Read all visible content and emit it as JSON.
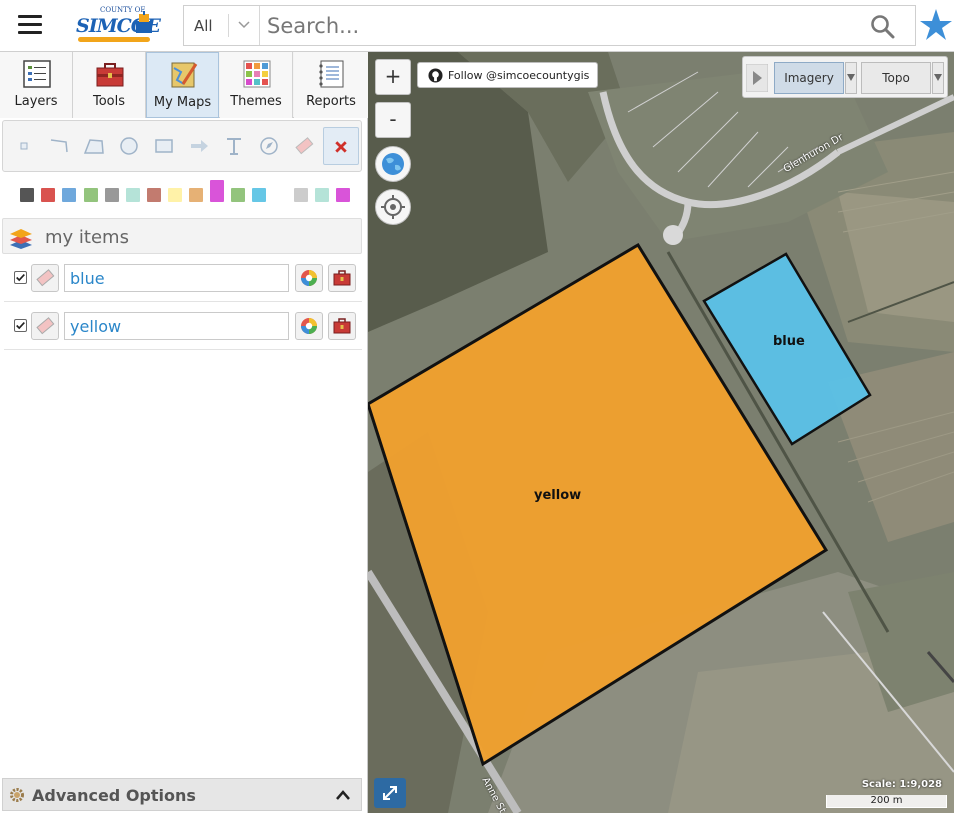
{
  "header": {
    "logo_top": "COUNTY OF",
    "logo_main": "SIMCOE",
    "search_category": "All",
    "search_placeholder": "Search..."
  },
  "tabs": [
    {
      "label": "Layers",
      "icon": "layers-list-icon"
    },
    {
      "label": "Tools",
      "icon": "toolbox-icon"
    },
    {
      "label": "My Maps",
      "icon": "my-maps-icon",
      "active": true
    },
    {
      "label": "Themes",
      "icon": "themes-grid-icon"
    },
    {
      "label": "Reports",
      "icon": "reports-notebook-icon"
    }
  ],
  "draw_tools": [
    "point",
    "line",
    "polygon",
    "circle",
    "rectangle",
    "arrow",
    "text",
    "measure",
    "eraser",
    "cancel"
  ],
  "palette": [
    "#555555",
    "#d9534f",
    "#6fa8dc",
    "#93c47d",
    "#999999",
    "#b5e3d8",
    "#c27b6f",
    "#fff2a8",
    "#e6b175",
    "#d954d9",
    "#93c47d",
    "#66c7e6",
    "#ffffff",
    "#cccccc",
    "#b5e3d8",
    "#d954d9"
  ],
  "my_items": {
    "title": "my items",
    "items": [
      {
        "name": "blue",
        "checked": true
      },
      {
        "name": "yellow",
        "checked": true
      }
    ]
  },
  "advanced_options": "Advanced Options",
  "map": {
    "zoom_in": "+",
    "zoom_out": "-",
    "follow_text": "Follow @simcoecountygis",
    "basemaps": [
      {
        "label": "Imagery",
        "selected": true
      },
      {
        "label": "Topo",
        "selected": false
      }
    ],
    "scale_text": "Scale: 1:9,028",
    "scale_bar": "200 m",
    "road_labels": [
      "Glenhuron Dr",
      "Anne St"
    ],
    "shapes": [
      {
        "label": "yellow",
        "color": "#efa02e"
      },
      {
        "label": "blue",
        "color": "#5bc2e8"
      }
    ]
  }
}
